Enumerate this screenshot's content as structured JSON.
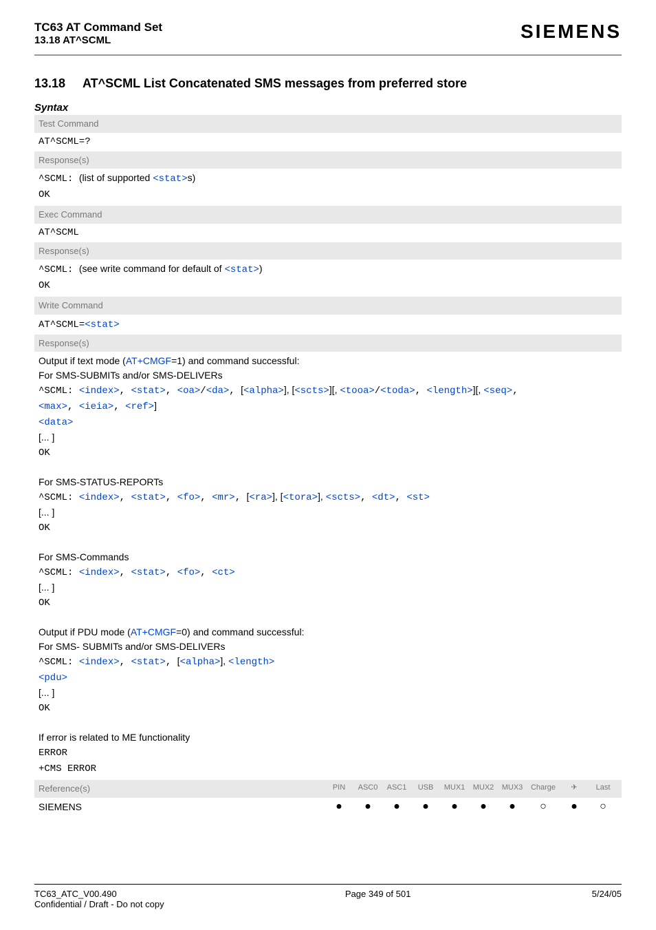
{
  "header": {
    "title": "TC63 AT Command Set",
    "subtitle": "13.18 AT^SCML",
    "brand": "SIEMENS"
  },
  "section": {
    "number": "13.18",
    "title": "AT^SCML   List Concatenated SMS messages from preferred store"
  },
  "syntax_label": "Syntax",
  "test_block": {
    "label": "Test Command",
    "cmd": "AT^SCML=?",
    "resp_label": "Response(s)",
    "line1_prefix": "^SCML: ",
    "line1_text": "(list of supported ",
    "line1_param": "<stat>",
    "line1_suffix": "s)",
    "ok": "OK"
  },
  "exec_block": {
    "label": "Exec Command",
    "cmd": "AT^SCML",
    "resp_label": "Response(s)",
    "line1_prefix": "^SCML: ",
    "line1_text": "(see write command for default of ",
    "line1_param": "<stat>",
    "line1_suffix": ")",
    "ok": "OK"
  },
  "write_block": {
    "label": "Write Command",
    "cmd_prefix": "AT^SCML=",
    "cmd_param": "<stat>",
    "resp_label": "Response(s)",
    "text_mode_intro1": "Output if text mode (",
    "text_mode_link": "AT+CMGF",
    "text_mode_intro2": "=1) and command successful:",
    "text_mode_line2": "For SMS-SUBMITs and/or SMS-DELIVERs",
    "scml_prefix": "^SCML: ",
    "p_index": "<index>",
    "p_stat": "<stat>",
    "p_oa": "<oa>",
    "p_da": "<da>",
    "p_alpha": "<alpha>",
    "p_scts": "<scts>",
    "p_tooa": "<tooa>",
    "p_toda": "<toda>",
    "p_length": "<length>",
    "p_seq": "<seq>",
    "p_max": "<max>",
    "p_ieia": "<ieia>",
    "p_ref": "<ref>",
    "p_data": "<data>",
    "ellipsis": "[... ]",
    "ok": "OK",
    "status_reports": "For SMS-STATUS-REPORTs",
    "p_fo": "<fo>",
    "p_mr": "<mr>",
    "p_ra": "<ra>",
    "p_tora": "<tora>",
    "p_dt": "<dt>",
    "p_st": "<st>",
    "sms_commands": "For SMS-Commands",
    "p_ct": "<ct>",
    "pdu_intro1": "Output if PDU mode (",
    "pdu_link": "AT+CMGF",
    "pdu_intro2": "=0) and command successful:",
    "pdu_line2": "For SMS- SUBMITs and/or SMS-DELIVERs",
    "p_pdu": "<pdu>",
    "err_line": "If error is related to ME functionality",
    "error": "ERROR",
    "cms_error": "+CMS ERROR"
  },
  "ref": {
    "label": "Reference(s)",
    "vendor": "SIEMENS",
    "cols": [
      "PIN",
      "ASC0",
      "ASC1",
      "USB",
      "MUX1",
      "MUX2",
      "MUX3",
      "Charge",
      "✈",
      "Last"
    ],
    "dots": [
      "●",
      "●",
      "●",
      "●",
      "●",
      "●",
      "●",
      "○",
      "●",
      "○"
    ]
  },
  "footer": {
    "left1": "TC63_ATC_V00.490",
    "left2": "Confidential / Draft - Do not copy",
    "center": "Page 349 of 501",
    "right": "5/24/05"
  }
}
